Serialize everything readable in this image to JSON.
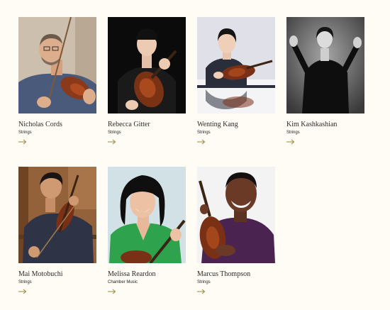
{
  "people": [
    {
      "name": "Nicholas Cords",
      "dept": "Strings",
      "bg": "#c9b9a5",
      "fg": "#4a5a78"
    },
    {
      "name": "Rebecca Gitter",
      "dept": "Strings",
      "bg": "#0e0e0e",
      "fg": "#1c1c1c"
    },
    {
      "name": "Wenting Kang",
      "dept": "Strings",
      "bg": "#dcdde6",
      "fg": "#2c2f3b"
    },
    {
      "name": "Kim Kashkashian",
      "dept": "Strings",
      "bg": "#7b7b7b",
      "fg": "#1a1a1a"
    },
    {
      "name": "Mai Motobuchi",
      "dept": "Strings",
      "bg": "#8a5a30",
      "fg": "#2f3346"
    },
    {
      "name": "Melissa Reardon",
      "dept": "Chamber Music",
      "bg": "#cfdfe3",
      "fg": "#2fa24a"
    },
    {
      "name": "Marcus Thompson",
      "dept": "Strings",
      "bg": "#f2f2f2",
      "fg": "#4c2450"
    }
  ],
  "arrow_icon": "arrow-right-icon",
  "accent": "#9a8a3a"
}
